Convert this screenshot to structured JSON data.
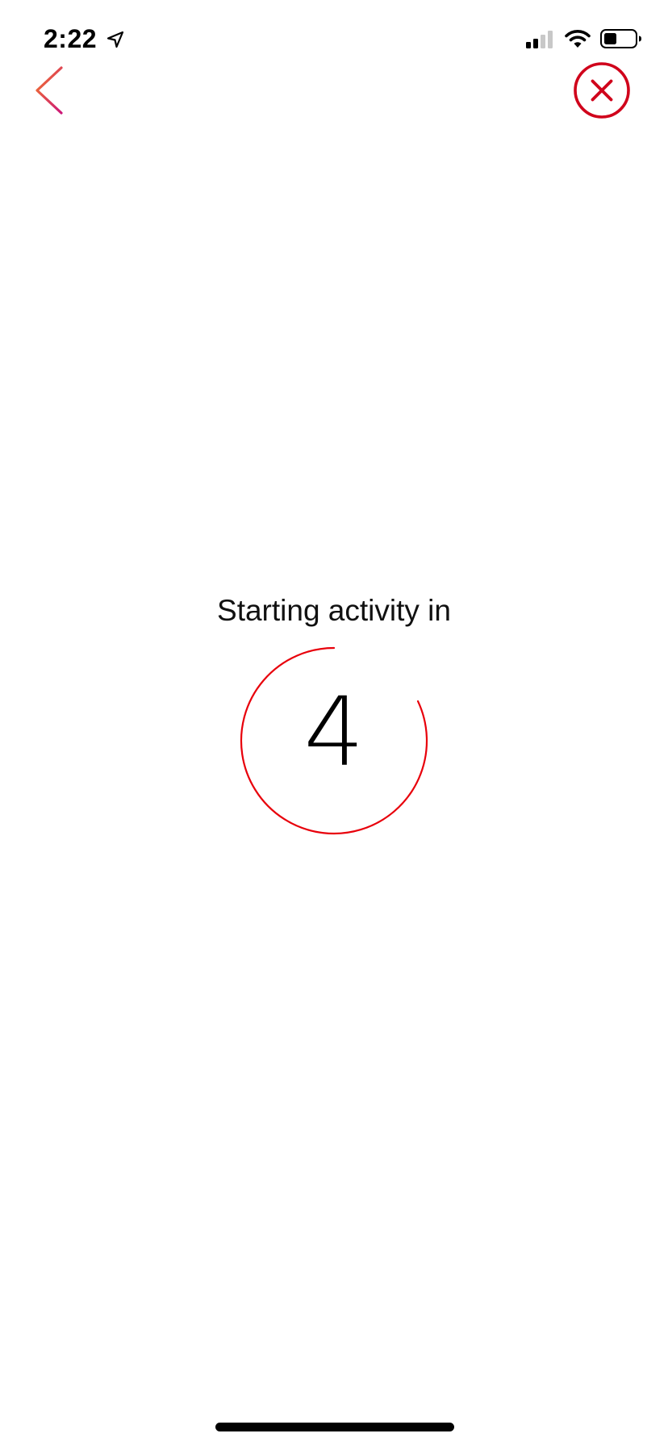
{
  "status_bar": {
    "time": "2:22",
    "icons": [
      "location-arrow-icon",
      "cellular-signal-icon",
      "wifi-icon",
      "battery-icon"
    ]
  },
  "nav": {
    "back_icon": "chevron-left-icon",
    "close_icon": "close-circle-icon"
  },
  "countdown": {
    "label": "Starting activity in",
    "value": "4",
    "progress": 0.82
  },
  "colors": {
    "accent_red": "#d0021b",
    "ring_red": "#e8000b",
    "back_gradient_start": "#f06a2a",
    "back_gradient_end": "#d01c7a",
    "text": "#111111"
  }
}
